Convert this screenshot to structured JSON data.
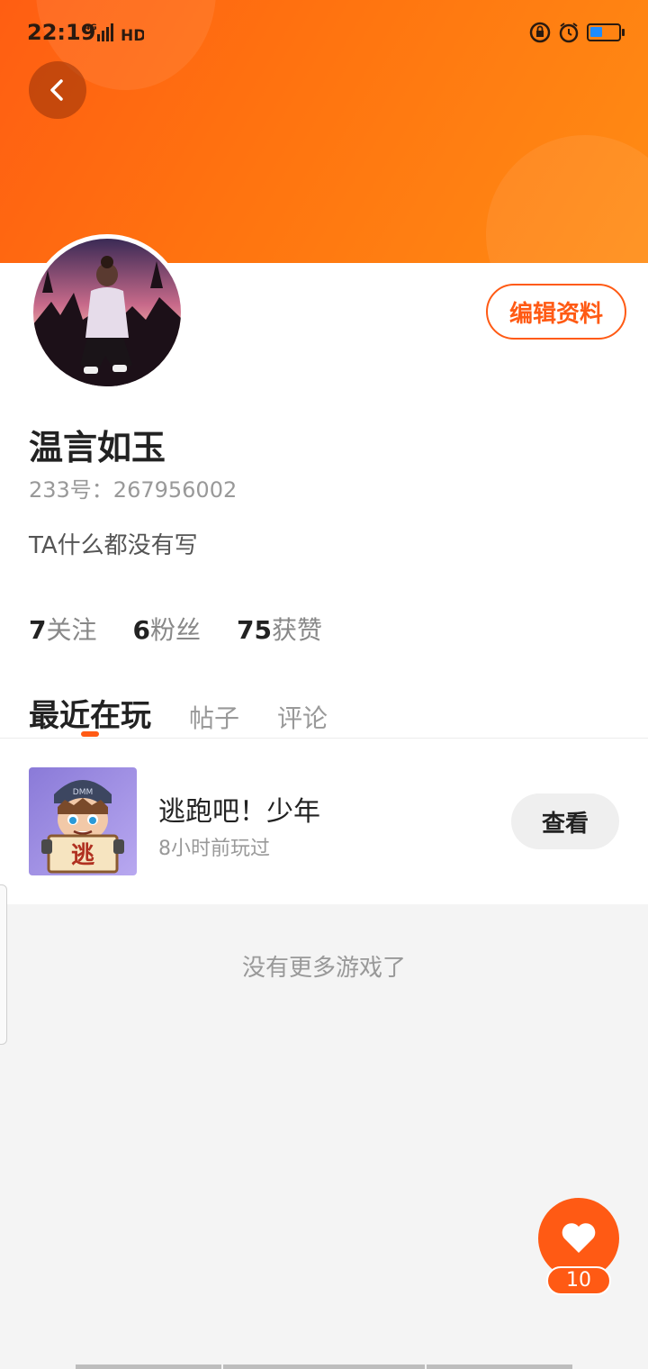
{
  "status_bar": {
    "time": "22:19",
    "network_indicator": "4G",
    "hd_label": "HD",
    "icons": [
      "rotation-lock-icon",
      "alarm-icon",
      "battery-icon"
    ],
    "battery_color": "#1e8cff"
  },
  "header": {
    "back_icon": "chevron-left-icon",
    "banner_colors": [
      "#ff5e12",
      "#ff8c14"
    ]
  },
  "profile": {
    "avatar": "avatar-image",
    "edit_button": "编辑资料",
    "name": "温言如玉",
    "uid_text": "233号：267956002",
    "bio": "TA什么都没有写",
    "stats": [
      {
        "value": "7",
        "label": "关注"
      },
      {
        "value": "6",
        "label": "粉丝"
      },
      {
        "value": "75",
        "label": "获赞"
      }
    ]
  },
  "tabs": [
    {
      "label": "最近在玩",
      "active": true
    },
    {
      "label": "帖子",
      "active": false
    },
    {
      "label": "评论",
      "active": false
    }
  ],
  "games": [
    {
      "title": "逃跑吧！少年",
      "last_played": "8小时前玩过",
      "icon_text": "逃",
      "cap_text": "DMM",
      "action_label": "查看"
    }
  ],
  "empty_message": "没有更多游戏了",
  "like_fab": {
    "icon": "heart-icon",
    "count": "10"
  },
  "accent_color": "#ff5a14"
}
